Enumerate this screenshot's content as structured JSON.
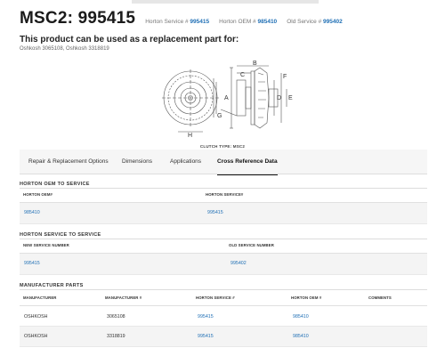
{
  "header": {
    "title": "MSC2: 995415",
    "refs": [
      {
        "label": "Horton Service # ",
        "value": "995415"
      },
      {
        "label": "Horton OEM # ",
        "value": "985410"
      },
      {
        "label": "Old Service # ",
        "value": "995402"
      }
    ]
  },
  "subtitle": "This product can be used as a replacement part for:",
  "applications": "Oshkosh 3065108, Oshkosh 3318819",
  "diagram": {
    "labels": [
      "A",
      "B",
      "C",
      "D",
      "E",
      "F",
      "G",
      "H"
    ],
    "caption": "CLUTCH TYPE: MSC2"
  },
  "tabs": [
    {
      "label": "Repair & Replacement Options",
      "active": false
    },
    {
      "label": "Dimensions",
      "active": false
    },
    {
      "label": "Applications",
      "active": false
    },
    {
      "label": "Cross Reference Data",
      "active": true
    }
  ],
  "oem_to_service": {
    "title": "HORTON OEM TO SERVICE",
    "headers": [
      "HORTON OEM#",
      "HORTON SERVICE#"
    ],
    "rows": [
      [
        "985410",
        "995415"
      ]
    ]
  },
  "service_to_service": {
    "title": "HORTON SERVICE TO SERVICE",
    "headers": [
      "NEW SERVICE NUMBER",
      "OLD SERVICE NUMBER"
    ],
    "rows": [
      [
        "995415",
        "995402"
      ]
    ]
  },
  "manufacturer_parts": {
    "title": "MANUFACTURER PARTS",
    "headers": [
      "MANUFACTURER",
      "MANUFACTURER #",
      "HORTON SERVICE #",
      "HORTON OEM #",
      "COMMENTS"
    ],
    "rows": [
      [
        "OSHKOSH",
        "3065108",
        "995415",
        "985410",
        ""
      ],
      [
        "OSHKOSH",
        "3318819",
        "995415",
        "985410",
        ""
      ]
    ]
  },
  "colors": {
    "link": "#1f6fb5",
    "text": "#222222",
    "row_bg": "#f4f4f4"
  }
}
